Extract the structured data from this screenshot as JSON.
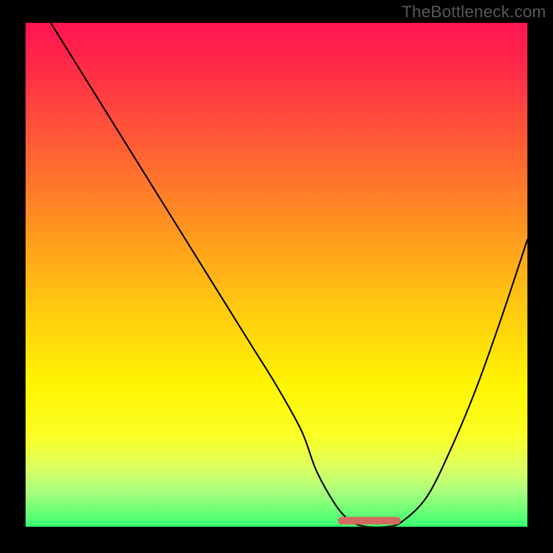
{
  "watermark": "TheBottleneck.com",
  "chart_data": {
    "type": "line",
    "title": "",
    "xlabel": "",
    "ylabel": "",
    "xlim": [
      0,
      100
    ],
    "ylim": [
      0,
      100
    ],
    "grid": false,
    "series": [
      {
        "name": "curve",
        "x": [
          5,
          10,
          15,
          20,
          25,
          30,
          35,
          40,
          45,
          50,
          55,
          58,
          62,
          65,
          68,
          72,
          75,
          80,
          85,
          90,
          95,
          100
        ],
        "y": [
          100,
          92,
          84,
          76,
          68,
          60,
          52,
          44,
          36,
          28,
          19,
          11,
          4,
          1,
          0,
          0,
          1,
          6,
          16,
          28,
          42,
          57
        ]
      }
    ],
    "highlight_segment": {
      "name": "flat-valley",
      "x": [
        63,
        74
      ],
      "y": [
        1.2,
        1.2
      ],
      "color": "#d46a60"
    },
    "background_gradient_stops": [
      {
        "pos": 0,
        "color": "#ff1452"
      },
      {
        "pos": 22,
        "color": "#ff5638"
      },
      {
        "pos": 55,
        "color": "#ffc512"
      },
      {
        "pos": 72,
        "color": "#fff601"
      },
      {
        "pos": 93,
        "color": "#a9ff7d"
      },
      {
        "pos": 100,
        "color": "#39ff6f"
      }
    ]
  }
}
